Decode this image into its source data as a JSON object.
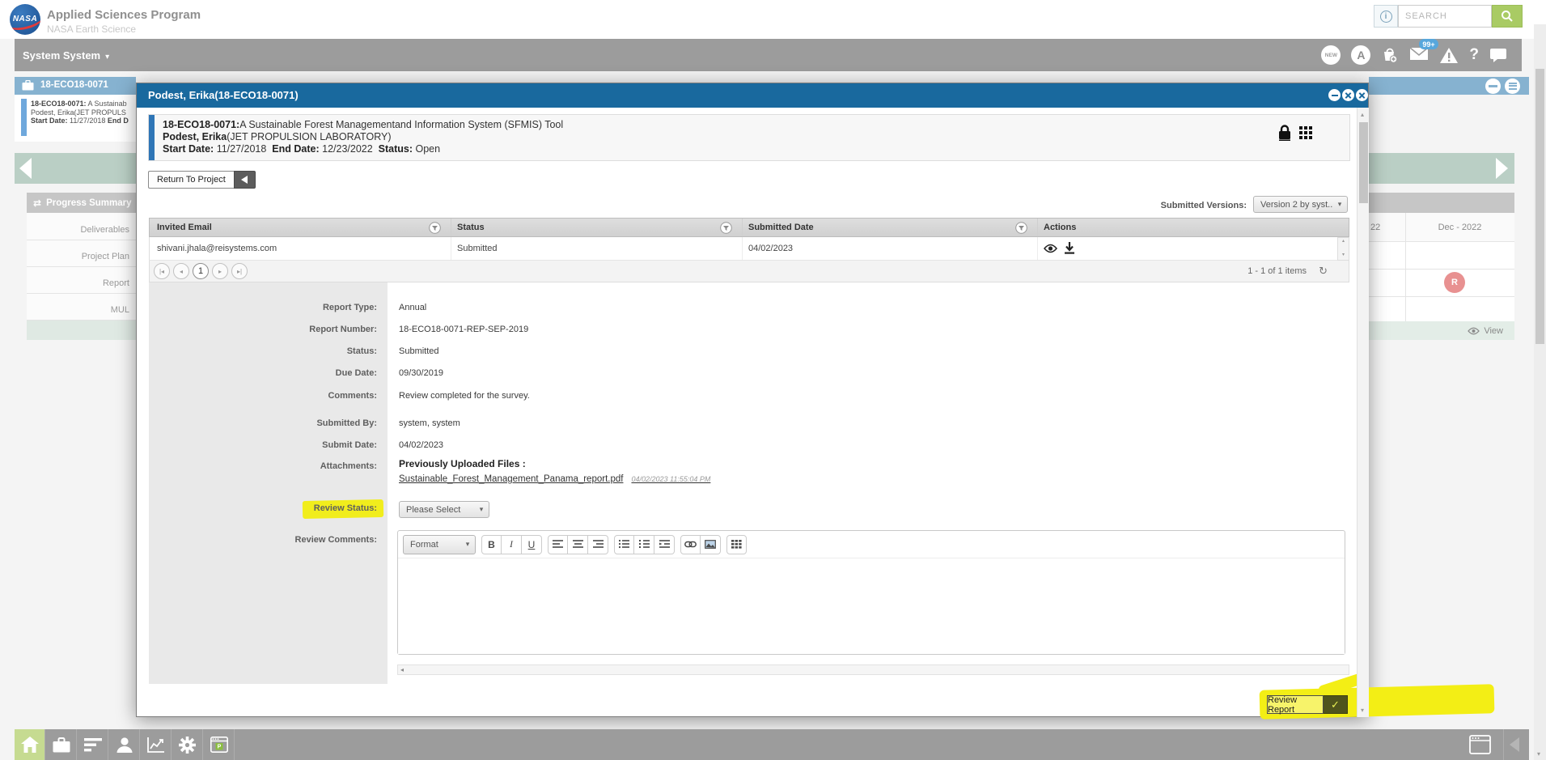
{
  "colors": {
    "modal_titlebar_blue": "#19699e",
    "window_titlebar_blue": "#86b2d0",
    "nav_gray": "#9c9c9c",
    "search_green": "#a9cb64",
    "highlight_yellow": "#f1ed1c",
    "band_green": "#bacfc5",
    "badge_pink": "#e89191",
    "badge_blue": "#58a7dc",
    "home_green": "#c6db91"
  },
  "icons": {
    "chevron_down": "▾",
    "up_small": "▴",
    "down_small": "▾",
    "left_small": "◂",
    "right_small": "▸",
    "refresh": "↻",
    "check": "✓",
    "question_mark": "?",
    "info": "i",
    "sync": "⇄",
    "avatar_letter": "A",
    "bold": "B",
    "italic": "I",
    "underline": "U"
  },
  "header": {
    "logo_text": "NASA",
    "app_title": "Applied Sciences Program",
    "app_subtitle": "NASA Earth Science",
    "search_placeholder": "SEARCH"
  },
  "navbar": {
    "user_menu": "System System",
    "new_label": "NEW",
    "mail_badge": "99+"
  },
  "background": {
    "window_title": "18-ECO18-0071",
    "card_line1_code": "18-ECO18-0071:",
    "card_line1_rest": " A Sustainab",
    "card_line2": "Podest, Erika(JET PROPULS",
    "card_line3_start_label": "Start Date:",
    "card_line3_start_value": " 11/27/2018 ",
    "card_line3_end_label": "End D",
    "panel_title": "Progress Summary",
    "rows": [
      "Deliverables",
      "Project Plan",
      "Report",
      "MUL"
    ],
    "month_partial": "22",
    "month_dec": "Dec - 2022",
    "badge_r": "R",
    "view_label": "View"
  },
  "modal": {
    "title": "Podest, Erika(18-ECO18-0071)",
    "project": {
      "code": "18-ECO18-0071:",
      "name": "A Sustainable Forest Managementand Information System (SFMIS) Tool",
      "pi": "Podest, Erika",
      "org": "(JET PROPULSION LABORATORY)",
      "start_label": "Start Date:",
      "start_value": "11/27/2018",
      "end_label": "End Date:",
      "end_value": "12/23/2022",
      "status_label": "Status:",
      "status_value": "Open"
    },
    "return_button": "Return To Project",
    "versions_label": "Submitted Versions:",
    "versions_value": "Version 2 by syst...",
    "table": {
      "col_email": "Invited Email",
      "col_status": "Status",
      "col_date": "Submitted Date",
      "col_actions": "Actions",
      "row": {
        "email": "shivani.jhala@reisystems.com",
        "status": "Submitted",
        "date": "04/02/2023"
      }
    },
    "pagination": {
      "page": "1",
      "items": "1 - 1 of 1 items"
    },
    "form": {
      "report_type_label": "Report Type:",
      "report_type": "Annual",
      "report_number_label": "Report Number:",
      "report_number": "18-ECO18-0071-REP-SEP-2019",
      "status_label": "Status:",
      "status": "Submitted",
      "due_date_label": "Due Date:",
      "due_date": "09/30/2019",
      "comments_label": "Comments:",
      "comments": "Review completed for the survey.",
      "submitted_by_label": "Submitted By:",
      "submitted_by": "system, system",
      "submit_date_label": "Submit Date:",
      "submit_date": "04/02/2023",
      "attachments_label": "Attachments:",
      "attachments_heading": "Previously Uploaded Files :",
      "attachment_file": "Sustainable_Forest_Management_Panama_report.pdf",
      "attachment_time": "04/02/2023 11:55:04 PM",
      "review_status_label": "Review Status:",
      "review_status_value": "Please Select",
      "review_comments_label": "Review Comments:"
    },
    "editor": {
      "format_label": "Format"
    },
    "review_button": "Review Report"
  }
}
